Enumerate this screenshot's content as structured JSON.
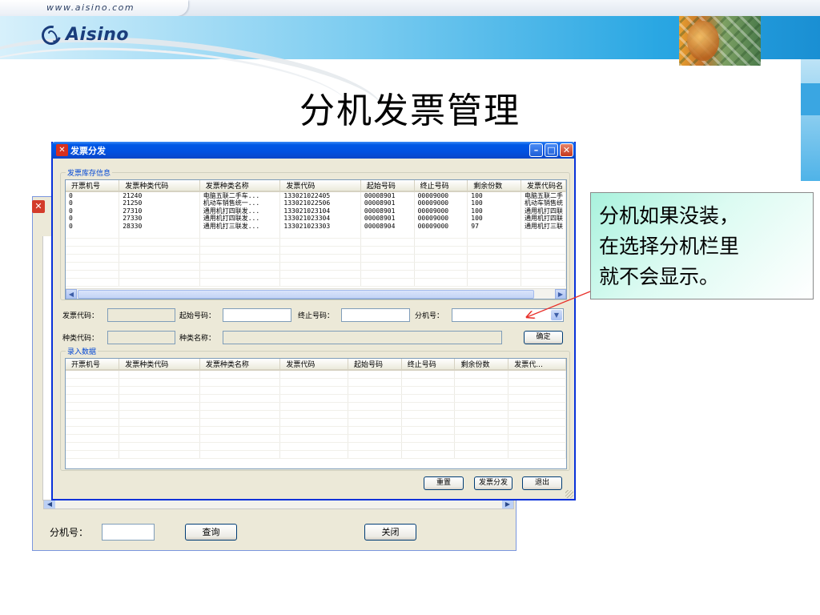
{
  "banner": {
    "url": "www.aisino.com",
    "logo_text": "Aisino"
  },
  "slide": {
    "title": "分机发票管理"
  },
  "background_window": {
    "branch_label": "分机号：",
    "query_button": "查询",
    "close_button": "关闭"
  },
  "dialog": {
    "title": "发票分发",
    "inventory_group": "发票库存信息",
    "inventory_columns": [
      "开票机号",
      "发票种类代码",
      "发票种类名称",
      "发票代码",
      "起始号码",
      "终止号码",
      "剩余份数",
      "发票代码名"
    ],
    "inventory_rows": [
      [
        "0",
        "21240",
        "电脑五联二手车...",
        "133021022405",
        "00008901",
        "00009000",
        "100",
        "电脑五联二手"
      ],
      [
        "0",
        "21250",
        "机动车销售统一...",
        "133021022506",
        "00008901",
        "00009000",
        "100",
        "机动车销售统"
      ],
      [
        "0",
        "27310",
        "通用机打四联发...",
        "133021023104",
        "00008901",
        "00009000",
        "100",
        "通用机打四联"
      ],
      [
        "0",
        "27330",
        "通用机打四联发...",
        "133021023304",
        "00008901",
        "00009000",
        "100",
        "通用机打四联"
      ],
      [
        "0",
        "28330",
        "通用机打三联发...",
        "133021023303",
        "00008904",
        "00009000",
        "97",
        "通用机打三联"
      ]
    ],
    "fields": {
      "invoice_code_label": "发票代码：",
      "start_no_label": "起始号码：",
      "end_no_label": "终止号码：",
      "branch_no_label": "分机号：",
      "type_code_label": "种类代码：",
      "type_name_label": "种类名称：",
      "confirm_button": "确定"
    },
    "entry_group": "录入数据",
    "entry_columns": [
      "开票机号",
      "发票种类代码",
      "发票种类名称",
      "发票代码",
      "起始号码",
      "终止号码",
      "剩余份数",
      "发票代..."
    ],
    "buttons": {
      "reset": "重置",
      "distribute": "发票分发",
      "exit": "退出"
    }
  },
  "callout": {
    "lines": [
      "分机如果没装，",
      "在选择分机栏里",
      "就不会显示。"
    ]
  },
  "colors": {
    "titlebar": "#0058e6",
    "dialog_bg": "#ece9d8",
    "group_label": "#0046d5",
    "callout_arrow": "#e8302a"
  }
}
